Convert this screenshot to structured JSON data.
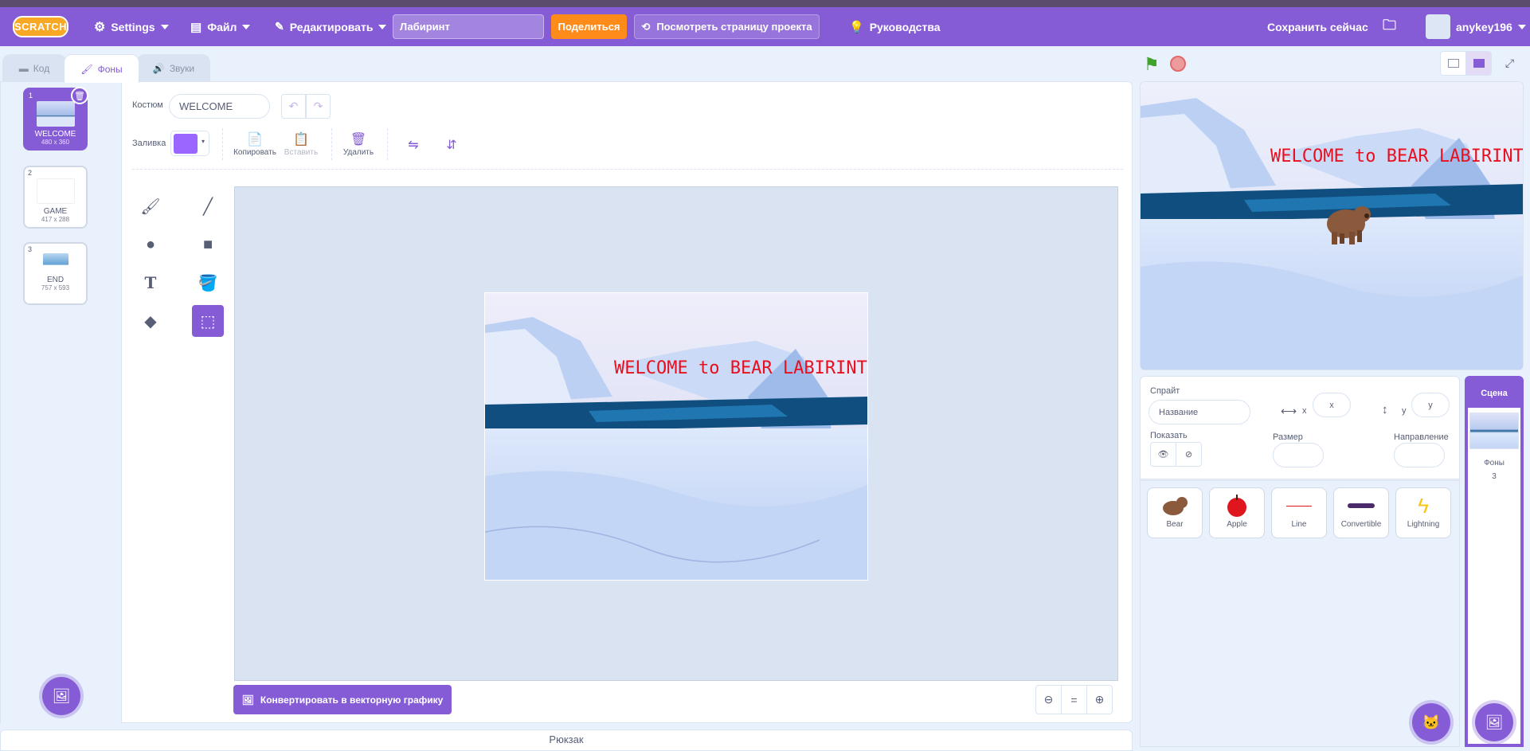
{
  "menubar": {
    "logo": "SCRATCH",
    "settings": "Settings",
    "file": "Файл",
    "edit": "Редактировать",
    "project_title": "Лабиринт",
    "share": "Поделиться",
    "project_page": "Посмотреть страницу проекта",
    "tutorials": "Руководства",
    "save_now": "Сохранить сейчас",
    "username": "anykey196"
  },
  "tabs": [
    {
      "label": "Код"
    },
    {
      "label": "Фоны"
    },
    {
      "label": "Звуки"
    }
  ],
  "costumes": [
    {
      "num": "1",
      "name": "WELCOME",
      "size": "480 x 360"
    },
    {
      "num": "2",
      "name": "GAME",
      "size": "417 x 288"
    },
    {
      "num": "3",
      "name": "END",
      "size": "757 x 593"
    }
  ],
  "paint": {
    "costume_label": "Костюм",
    "costume_name": "WELCOME",
    "fill_label": "Заливка",
    "fill_color": "#9966ff",
    "copy": "Копировать",
    "paste": "Вставить",
    "delete": "Удалить",
    "convert": "Конвертировать в векторную графику",
    "zoom_reset": "="
  },
  "artwork_text": "WELCOME to BEAR LABIRINT",
  "backpack": "Рюкзак",
  "sprite_info": {
    "sprite_label": "Спрайт",
    "name_placeholder": "Название",
    "x_label": "x",
    "x_placeholder": "x",
    "y_label": "y",
    "y_placeholder": "y",
    "show_label": "Показать",
    "size_label": "Размер",
    "direction_label": "Направление"
  },
  "sprites": [
    {
      "name": "Bear"
    },
    {
      "name": "Apple"
    },
    {
      "name": "Line"
    },
    {
      "name": "Convertible"
    },
    {
      "name": "Lightning"
    }
  ],
  "stage_panel": {
    "title": "Сцена",
    "backdrops_label": "Фоны",
    "backdrops_count": "3"
  },
  "colors": {
    "accent": "#855cd6",
    "share": "#ff8c1a",
    "text_red": "#e8101e"
  }
}
